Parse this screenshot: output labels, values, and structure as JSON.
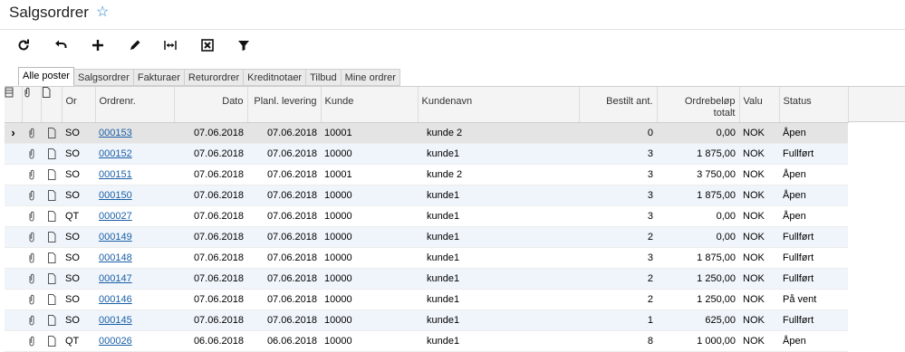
{
  "header": {
    "title": "Salgsordrer"
  },
  "toolbar": {
    "buttons": [
      {
        "icon": "refresh-icon"
      },
      {
        "icon": "undo-icon"
      },
      {
        "icon": "add-icon"
      },
      {
        "icon": "edit-icon"
      },
      {
        "icon": "fit-width-icon"
      },
      {
        "icon": "export-excel-icon"
      },
      {
        "icon": "filter-icon"
      }
    ]
  },
  "tabs": [
    "Alle poster",
    "Salgsordrer",
    "Fakturaer",
    "Returordrer",
    "Kreditnotaer",
    "Tilbud",
    "Mine ordrer"
  ],
  "grid": {
    "columns": [
      "Or",
      "Ordrenr.",
      "Dato",
      "Planl. levering",
      "Kunde",
      "Kundenavn",
      "Bestilt ant.",
      "Ordrebeløp totalt",
      "Valu",
      "Status"
    ],
    "rows": [
      {
        "type": "SO",
        "nr": "000153",
        "date": "07.06.2018",
        "planned": "07.06.2018",
        "customer": "10001",
        "name": "kunde 2",
        "qty": "0",
        "amount": "0,00",
        "currency": "NOK",
        "status": "Åpen"
      },
      {
        "type": "SO",
        "nr": "000152",
        "date": "07.06.2018",
        "planned": "07.06.2018",
        "customer": "10000",
        "name": "kunde1",
        "qty": "3",
        "amount": "1 875,00",
        "currency": "NOK",
        "status": "Fullført"
      },
      {
        "type": "SO",
        "nr": "000151",
        "date": "07.06.2018",
        "planned": "07.06.2018",
        "customer": "10001",
        "name": "kunde 2",
        "qty": "3",
        "amount": "3 750,00",
        "currency": "NOK",
        "status": "Åpen"
      },
      {
        "type": "SO",
        "nr": "000150",
        "date": "07.06.2018",
        "planned": "07.06.2018",
        "customer": "10000",
        "name": "kunde1",
        "qty": "3",
        "amount": "1 875,00",
        "currency": "NOK",
        "status": "Åpen"
      },
      {
        "type": "QT",
        "nr": "000027",
        "date": "07.06.2018",
        "planned": "07.06.2018",
        "customer": "10000",
        "name": "kunde1",
        "qty": "3",
        "amount": "0,00",
        "currency": "NOK",
        "status": "Åpen"
      },
      {
        "type": "SO",
        "nr": "000149",
        "date": "07.06.2018",
        "planned": "07.06.2018",
        "customer": "10000",
        "name": "kunde1",
        "qty": "2",
        "amount": "0,00",
        "currency": "NOK",
        "status": "Fullført"
      },
      {
        "type": "SO",
        "nr": "000148",
        "date": "07.06.2018",
        "planned": "07.06.2018",
        "customer": "10000",
        "name": "kunde1",
        "qty": "3",
        "amount": "1 875,00",
        "currency": "NOK",
        "status": "Fullført"
      },
      {
        "type": "SO",
        "nr": "000147",
        "date": "07.06.2018",
        "planned": "07.06.2018",
        "customer": "10000",
        "name": "kunde1",
        "qty": "2",
        "amount": "1 250,00",
        "currency": "NOK",
        "status": "Fullført"
      },
      {
        "type": "SO",
        "nr": "000146",
        "date": "07.06.2018",
        "planned": "07.06.2018",
        "customer": "10000",
        "name": "kunde1",
        "qty": "2",
        "amount": "1 250,00",
        "currency": "NOK",
        "status": "På vent"
      },
      {
        "type": "SO",
        "nr": "000145",
        "date": "07.06.2018",
        "planned": "07.06.2018",
        "customer": "10000",
        "name": "kunde1",
        "qty": "1",
        "amount": "625,00",
        "currency": "NOK",
        "status": "Fullført"
      },
      {
        "type": "QT",
        "nr": "000026",
        "date": "06.06.2018",
        "planned": "06.06.2018",
        "customer": "10000",
        "name": "kunde1",
        "qty": "8",
        "amount": "1 000,00",
        "currency": "NOK",
        "status": "Åpen"
      }
    ]
  },
  "colors": {
    "link": "#1a5fa6",
    "star": "#1a7fd0",
    "selected_row": "#e4e4e4",
    "alt_row": "#f0f5fb"
  }
}
